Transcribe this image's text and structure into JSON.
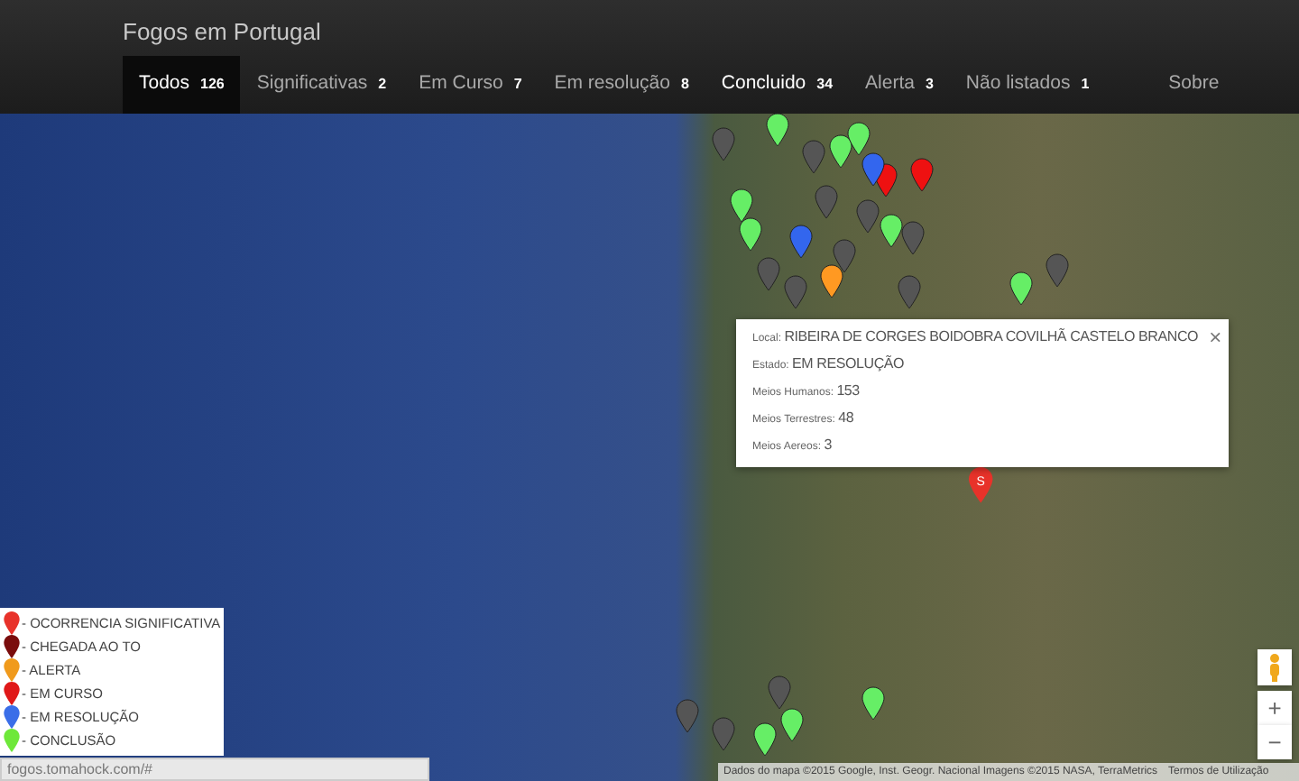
{
  "navbar": {
    "brand": "Fogos em Portugal",
    "items": [
      {
        "label": "Todos",
        "count": "126",
        "selected": true,
        "emphasized": false
      },
      {
        "label": "Significativas",
        "count": "2",
        "selected": false,
        "emphasized": false
      },
      {
        "label": "Em Curso",
        "count": "7",
        "selected": false,
        "emphasized": false
      },
      {
        "label": "Em resolução",
        "count": "8",
        "selected": false,
        "emphasized": false
      },
      {
        "label": "Concluido",
        "count": "34",
        "selected": false,
        "emphasized": true
      },
      {
        "label": "Alerta",
        "count": "3",
        "selected": false,
        "emphasized": false
      },
      {
        "label": "Não listados",
        "count": "1",
        "selected": false,
        "emphasized": false
      },
      {
        "label": "Sobre",
        "selected": false,
        "emphasized": false
      }
    ]
  },
  "map": {
    "marker_label": "S",
    "popup": {
      "close": "×",
      "fields": [
        {
          "label": "Local:",
          "value": "RIBEIRA DE CORGES BOIDOBRA COVILHÃ CASTELO BRANCO"
        },
        {
          "label": "Estado:",
          "value": "EM RESOLUÇÃO"
        },
        {
          "label": "Meios Humanos:",
          "value": "153"
        },
        {
          "label": "Meios Terrestres:",
          "value": "48"
        },
        {
          "label": "Meios Aereos:",
          "value": "3"
        }
      ]
    },
    "legend": [
      {
        "label": "- OCORRENCIA SIGNIFICATIVA",
        "color": "#e8322a"
      },
      {
        "label": "- CHEGADA AO TO",
        "color": "#7a0c0c"
      },
      {
        "label": "- ALERTA",
        "color": "#f09a1c"
      },
      {
        "label": "- EM CURSO",
        "color": "#e01818"
      },
      {
        "label": "- EM RESOLUÇÃO",
        "color": "#3a6ee8"
      },
      {
        "label": "- CONCLUSÃO",
        "color": "#6ee83a"
      }
    ],
    "zoom_in": "+",
    "zoom_out": "−",
    "attribution": "Dados do mapa ©2015 Google, Inst. Geogr. Nacional Imagens ©2015 NASA, TerraMetrics",
    "terms": "Termos de Utilização"
  },
  "status_bar": {
    "url": "fogos.tomahock.com/#"
  }
}
